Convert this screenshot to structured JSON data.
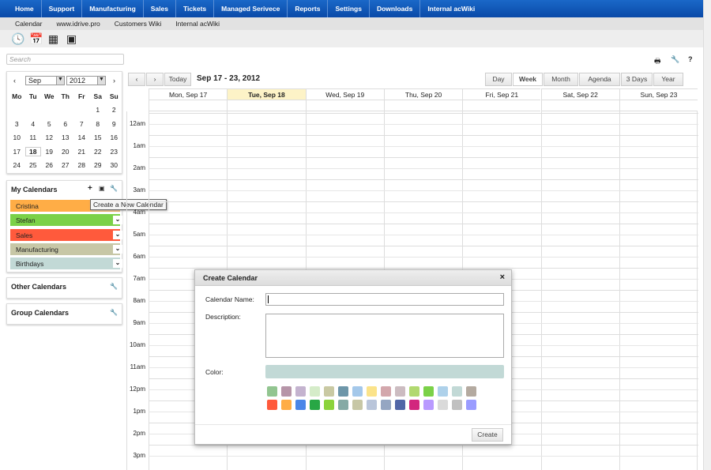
{
  "nav": [
    "Home",
    "Support",
    "Manufacturing",
    "Sales",
    "Tickets",
    "Managed Serivece",
    "Reports",
    "Settings",
    "Downloads",
    "Internal acWiki"
  ],
  "subnav": [
    "Calendar",
    "www.idrive.pro",
    "Customers Wiki",
    "Internal acWiki"
  ],
  "tools": [
    {
      "icon": "clock-icon",
      "glyph": "🕓"
    },
    {
      "icon": "calendar-icon",
      "glyph": "📅"
    },
    {
      "icon": "calculator-icon",
      "glyph": "▦"
    },
    {
      "icon": "gantt-icon",
      "glyph": "▣"
    }
  ],
  "search": {
    "placeholder": "Search"
  },
  "mini": {
    "month": "Sep",
    "year": "2012",
    "prev": "‹",
    "next": "›",
    "dow": [
      "Mo",
      "Tu",
      "We",
      "Th",
      "Fr",
      "Sa",
      "Su"
    ],
    "weeks": [
      [
        "",
        "",
        "",
        "",
        "",
        "1",
        "2"
      ],
      [
        "3",
        "4",
        "5",
        "6",
        "7",
        "8",
        "9"
      ],
      [
        "10",
        "11",
        "12",
        "13",
        "14",
        "15",
        "16"
      ],
      [
        "17",
        "18",
        "19",
        "20",
        "21",
        "22",
        "23"
      ],
      [
        "24",
        "25",
        "26",
        "27",
        "28",
        "29",
        "30"
      ]
    ],
    "today": "18"
  },
  "my_calendars": {
    "title": "My Calendars",
    "tooltip": "Create a New Calendar",
    "items": [
      {
        "name": "Cristina",
        "color": "#ffad46"
      },
      {
        "name": "Stefan",
        "color": "#7bd148"
      },
      {
        "name": "Sales",
        "color": "#ff5a3c"
      },
      {
        "name": "Manufacturing",
        "color": "#c7c7a6"
      },
      {
        "name": "Birthdays",
        "color": "#c2d9d6"
      }
    ]
  },
  "other_calendars": {
    "title": "Other Calendars"
  },
  "group_calendars": {
    "title": "Group Calendars"
  },
  "toolbar": {
    "prev": "‹",
    "next": "›",
    "today": "Today",
    "range": "Sep 17 - 23, 2012",
    "views": [
      "Day",
      "Week",
      "Month",
      "Agenda",
      "3 Days",
      "Year"
    ],
    "active_view": "Week"
  },
  "days": [
    "Mon, Sep 17",
    "Tue, Sep 18",
    "Wed, Sep 19",
    "Thu, Sep 20",
    "Fri, Sep 21",
    "Sat, Sep 22",
    "Sun, Sep 23"
  ],
  "today_index": 1,
  "hours": [
    "12am",
    "1am",
    "2am",
    "3am",
    "4am",
    "5am",
    "6am",
    "7am",
    "8am",
    "9am",
    "10am",
    "11am",
    "12pm",
    "1pm",
    "2pm",
    "3pm"
  ],
  "dialog": {
    "title": "Create Calendar",
    "close": "×",
    "name_label": "Calendar Name:",
    "name_value": "",
    "desc_label": "Description:",
    "color_label": "Color:",
    "selected_color": "#c2d9d6",
    "create": "Create",
    "swatches": [
      "#92c590",
      "#b695a8",
      "#c4b3cf",
      "#d5ecc9",
      "#c9c9a3",
      "#6d96a9",
      "#a4c8ea",
      "#fbe38a",
      "#d3a7ac",
      "#ccbcc1",
      "#b1d970",
      "#7bd148",
      "#aed1ea",
      "#c2d9d6",
      "#b4aaa0",
      "#ff5a3c",
      "#ffad46",
      "#4a86e8",
      "#28a745",
      "#8bd33c",
      "#85aaa5",
      "#c7c7a6",
      "#b9c5da",
      "#95a6c2",
      "#5166a7",
      "#d2267e",
      "#b99aff",
      "#dadada",
      "#c0c0c0",
      "#9a9cff"
    ]
  }
}
